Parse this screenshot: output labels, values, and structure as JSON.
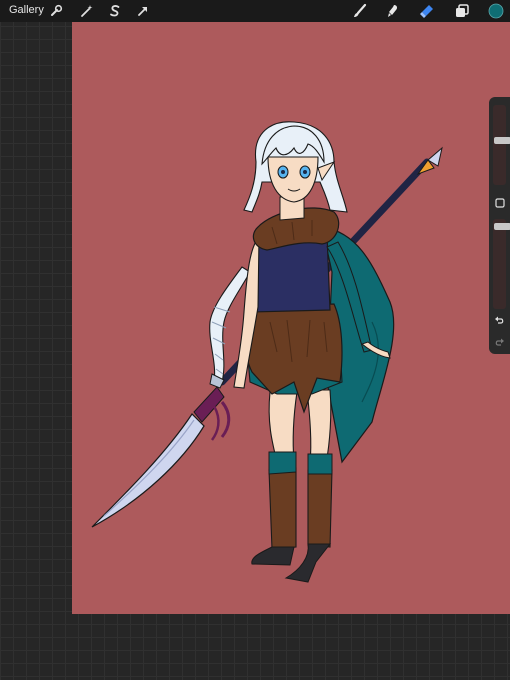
{
  "topbar": {
    "gallery_label": "Gallery",
    "left_tools": [
      "wrench-icon",
      "magic-wand-icon",
      "selection-s-icon",
      "transform-arrow-icon"
    ],
    "right_tools": [
      "brush-icon",
      "smudge-icon",
      "eraser-icon",
      "layers-icon",
      "color-swatch"
    ],
    "active_color": "#0f6e74"
  },
  "canvas": {
    "background_color": "#ad5a5c"
  },
  "sidebar": {
    "brush_size_slider": "size-slider",
    "opacity_slider": "opacity-slider",
    "modify_button": "square-modify-icon",
    "undo": "undo-icon",
    "redo": "redo-icon"
  },
  "colors": {
    "outfit_teal": "#0e6a72",
    "outfit_navy": "#2b2f63",
    "fur_brown": "#6a3d22",
    "skin": "#f7dcc4",
    "hair": "#e8f0f8",
    "blade": "#cfd6ef",
    "wrap_purple": "#6a1e55"
  }
}
